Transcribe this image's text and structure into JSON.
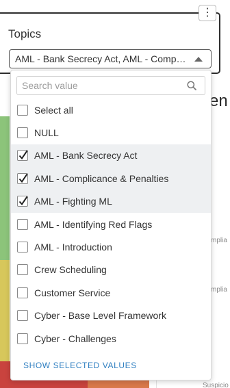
{
  "filter": {
    "title": "Topics",
    "selected_text": "AML - Bank Secrecy Act, AML - Complicance & Penalties, AML - Fighting ML",
    "menu_icon": "vertical-ellipsis-icon",
    "menu_glyph": "⋮"
  },
  "dropdown": {
    "search_placeholder": "Search value",
    "search_value": "",
    "options": [
      {
        "label": "Select all",
        "checked": false
      },
      {
        "label": "NULL",
        "checked": false
      },
      {
        "label": "AML - Bank Secrecy Act",
        "checked": true
      },
      {
        "label": "AML - Complicance & Penalties",
        "checked": true
      },
      {
        "label": "AML - Fighting ML",
        "checked": true
      },
      {
        "label": "AML - Identifying Red Flags",
        "checked": false
      },
      {
        "label": "AML - Introduction",
        "checked": false
      },
      {
        "label": "Crew Scheduling",
        "checked": false
      },
      {
        "label": "Customer Service",
        "checked": false
      },
      {
        "label": "Cyber - Base Level Framework",
        "checked": false
      },
      {
        "label": "Cyber - Challenges",
        "checked": false
      }
    ],
    "show_selected_label": "SHOW SELECTED VALUES"
  },
  "background": {
    "heading_fragment": "en",
    "label_fragment_1": "mplia",
    "label_fragment_2": "mplia",
    "label_fragment_3": "Suspicio"
  },
  "colors": {
    "link": "#2f7fc1",
    "selected_row": "#eef0f2",
    "green": "#8cc47a",
    "yellow": "#d7c75b",
    "red": "#c9433e",
    "orange": "#d9794a"
  }
}
